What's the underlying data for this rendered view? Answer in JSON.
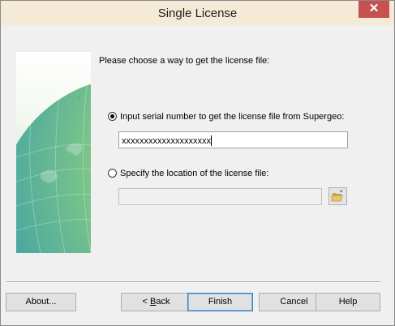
{
  "window": {
    "title": "Single License",
    "close_glyph": "✕"
  },
  "page": {
    "prompt": "Please choose a way to get the license file:",
    "option_serial": {
      "label": "Input serial number to get the license file from Supergeo:",
      "selected": true
    },
    "serial_input": {
      "value": "xxxxxxxxxxxxxxxxxxxx"
    },
    "option_location": {
      "label": "Specify the location of the license file:",
      "selected": false
    },
    "location_input": {
      "value": "",
      "enabled": false
    }
  },
  "buttons": {
    "about": "About...",
    "back_prefix": "< ",
    "back_accel": "B",
    "back_rest": "ack",
    "finish": "Finish",
    "cancel": "Cancel",
    "help": "Help"
  },
  "icons": {
    "browse": "folder-open-icon",
    "globe": "globe-image"
  }
}
